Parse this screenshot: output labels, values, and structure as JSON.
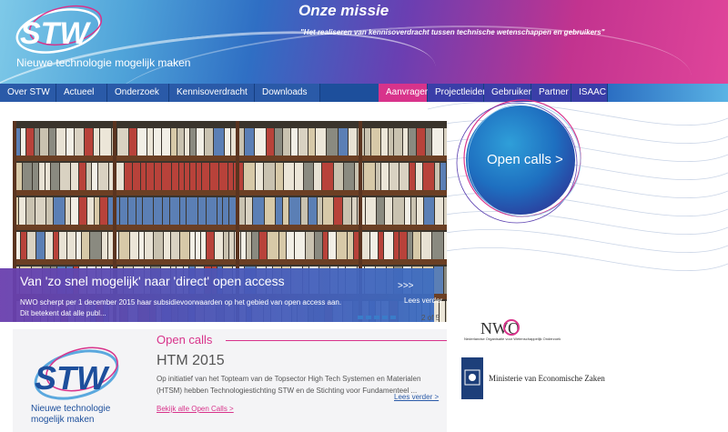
{
  "header": {
    "logo_text": "STW",
    "tagline": "Nieuwe technologie mogelijk maken",
    "mission_title": "Onze missie",
    "mission_text": "\"Het realiseren van kennisoverdracht tussen technische wetenschappen en gebruikers\""
  },
  "nav": {
    "left": [
      "Over STW",
      "Actueel",
      "Onderzoek",
      "Kennisoverdracht",
      "Downloads"
    ],
    "right": [
      "Aanvrager",
      "Projectleider",
      "Gebruiker",
      "Partner",
      "ISAAC"
    ]
  },
  "carousel": {
    "title": "Van 'zo snel mogelijk' naar 'direct' open access",
    "arrows": ">>>",
    "text": "NWO scherpt per 1 december 2015 haar subsidievoorwaarden op het gebied van open access aan. Dit betekent dat alle publ...",
    "more": "Lees verder",
    "pager": "2 of 5"
  },
  "bubble": {
    "label": "Open calls >"
  },
  "open_calls": {
    "heading": "Open calls",
    "title": "HTM 2015",
    "body": "Op initiatief van het Topteam van de Topsector High Tech Systemen en Materialen (HTSM) hebben Technologiestichting STW en de Stichting voor Fundamenteel ...",
    "more": "Lees verder >",
    "all": "Bekijk alle Open Calls >"
  },
  "lower_logo": {
    "text": "STW",
    "tagline_1": "Nieuwe technologie",
    "tagline_2": "mogelijk maken"
  },
  "sponsors": {
    "nwo": "NWO",
    "nwo_sub": "Nederlandse Organisatie voor Wetenschappelijk Onderzoek",
    "ministry": "Ministerie van Economische Zaken"
  },
  "colors": {
    "brand_blue": "#1d4f9c",
    "brand_magenta": "#d8338b"
  }
}
